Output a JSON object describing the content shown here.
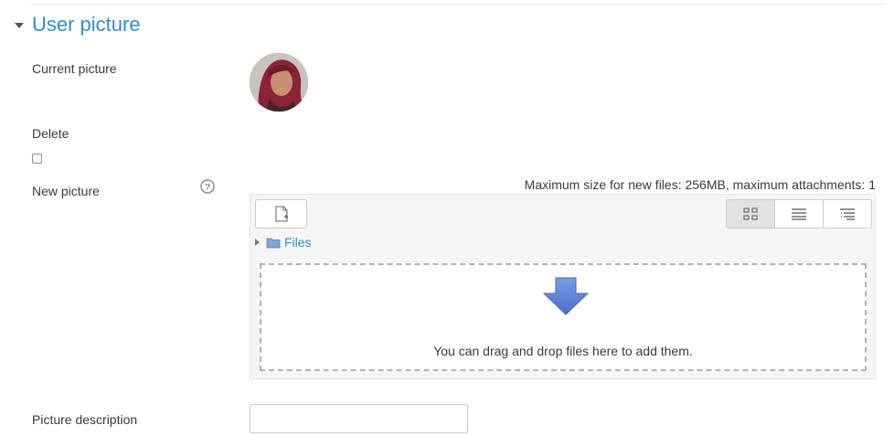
{
  "section": {
    "title": "User picture",
    "toggle_icon": "caret-down-icon"
  },
  "fields": {
    "current_picture_label": "Current picture",
    "delete_label": "Delete",
    "new_picture_label": "New picture",
    "picture_description_label": "Picture description",
    "picture_description_value": "",
    "picture_description_placeholder": ""
  },
  "filemanager": {
    "max_size_text": "Maximum size for new files: 256MB, maximum attachments: 1",
    "breadcrumb_label": "Files",
    "drop_text": "You can drag and drop files here to add them.",
    "view_modes": [
      "icons-view-icon",
      "list-view-icon",
      "tree-view-icon"
    ],
    "active_view": "icons-view-icon"
  },
  "colors": {
    "accent": "#2b8fcf",
    "text": "#373a3c",
    "panel_bg": "#f5f5f5",
    "arrow": "#5b7fd6"
  }
}
